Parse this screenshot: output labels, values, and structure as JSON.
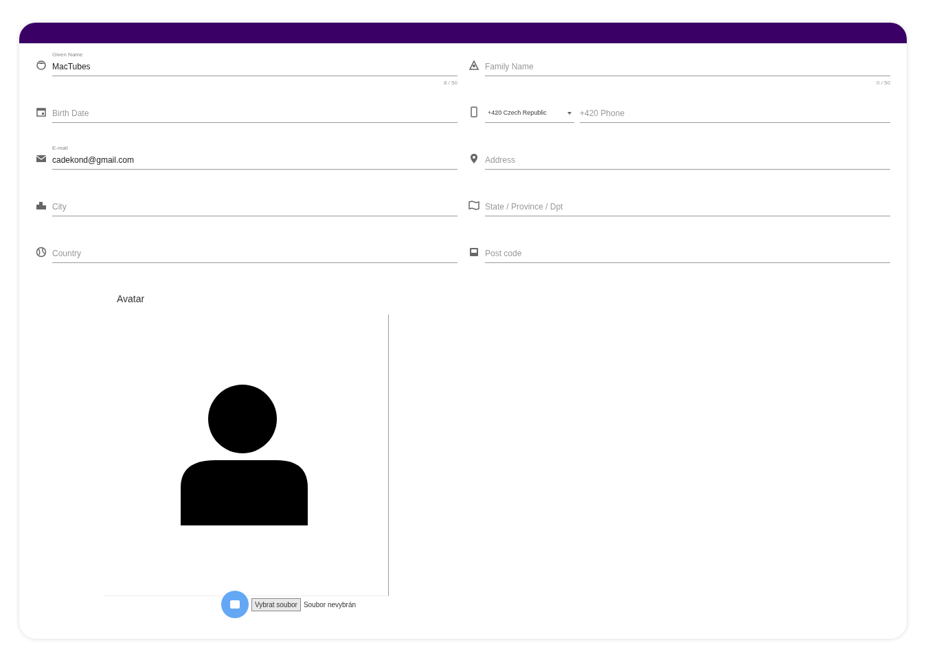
{
  "fields": [
    {
      "kind": "text",
      "label": "Given Name",
      "value": "MacTubes",
      "counter": "8 / 50"
    },
    {
      "kind": "text",
      "label": "Family Name",
      "counter": "0 / 50"
    },
    {
      "kind": "text",
      "label": "Birth Date"
    },
    {
      "kind": "phone",
      "country": "+420 Czech Republic",
      "label": "+420 Phone"
    },
    {
      "kind": "text",
      "label": "E-mail",
      "value": "cadekond@gmail.com"
    },
    {
      "kind": "text",
      "label": "Address"
    },
    {
      "kind": "text",
      "label": "City"
    },
    {
      "kind": "text",
      "label": "State / Province / Dpt"
    },
    {
      "kind": "text",
      "label": "Country"
    },
    {
      "kind": "text",
      "label": "Post code"
    }
  ],
  "avatar": {
    "label": "Avatar",
    "file_button": "Vybrat soubor",
    "file_status": "Soubor nevybrán"
  }
}
